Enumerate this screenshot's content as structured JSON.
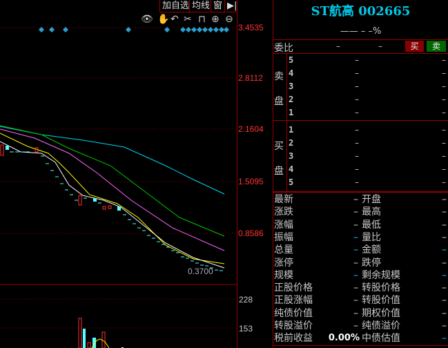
{
  "toolbar": {
    "add_watch": "加自选",
    "ma": "均线",
    "window": "窗",
    "icons": [
      "eye-icon",
      "hand-icon",
      "undo-icon",
      "scissors-icon",
      "lock-icon",
      "zoom-in-icon",
      "zoom-out-icon"
    ]
  },
  "axis": {
    "prices": [
      "3.4535",
      "2.8112",
      "2.1604",
      "1.5095",
      "0.8586"
    ],
    "last_price": "0.3700",
    "volume": [
      "228",
      "153"
    ]
  },
  "quote": {
    "title": "ST航高 002665",
    "change": "——  –  –%",
    "weibi_label": "委比",
    "weibi_v1": "–",
    "weibi_v2": "–",
    "buy_btn": "买",
    "sell_btn": "卖",
    "sell_label": [
      "卖",
      "盘"
    ],
    "buy_label": [
      "买",
      "盘"
    ],
    "sell": [
      {
        "level": "5",
        "price": "–",
        "vol": "–"
      },
      {
        "level": "4",
        "price": "–",
        "vol": "–"
      },
      {
        "level": "3",
        "price": "–",
        "vol": "–"
      },
      {
        "level": "2",
        "price": "–",
        "vol": "–"
      },
      {
        "level": "1",
        "price": "–",
        "vol": "–"
      }
    ],
    "buy": [
      {
        "level": "1",
        "price": "–",
        "vol": "–"
      },
      {
        "level": "2",
        "price": "–",
        "vol": "–"
      },
      {
        "level": "3",
        "price": "–",
        "vol": "–"
      },
      {
        "level": "4",
        "price": "–",
        "vol": "–"
      },
      {
        "level": "5",
        "price": "–",
        "vol": "–"
      }
    ]
  },
  "stats": [
    {
      "l1": "最新",
      "v1": "–",
      "l2": "开盘",
      "v2": "–"
    },
    {
      "l1": "涨跌",
      "v1": "–",
      "l2": "最高",
      "v2": "–"
    },
    {
      "l1": "涨幅",
      "v1": "–",
      "l2": "最低",
      "v2": "–"
    },
    {
      "l1": "振幅",
      "v1": "–",
      "l2": "量比",
      "v2": "–"
    },
    {
      "l1": "总量",
      "v1": "–",
      "l2": "金额",
      "v2": "–"
    },
    {
      "l1": "涨停",
      "v1": "–",
      "l2": "跌停",
      "v2": "–"
    },
    {
      "l1": "规模",
      "v1": "–",
      "l2": "剩余规模",
      "v2": "–"
    },
    {
      "l1": "正股价格",
      "v1": "–",
      "l2": "转股价格",
      "v2": "–"
    },
    {
      "l1": "正股涨幅",
      "v1": "–",
      "l2": "转股价值",
      "v2": "–"
    },
    {
      "l1": "纯债价值",
      "v1": "–",
      "l2": "期权价值",
      "v2": "–"
    },
    {
      "l1": "转股溢价",
      "v1": "–",
      "l2": "纯债溢价",
      "v2": "–"
    },
    {
      "l1": "税前收益",
      "v1": "0.00%",
      "l2": "中债估值",
      "v2": "–"
    }
  ],
  "colors": {
    "border": "#990000",
    "title": "#00c8e6",
    "up": "#ff3232",
    "down": "#54ffff"
  }
}
